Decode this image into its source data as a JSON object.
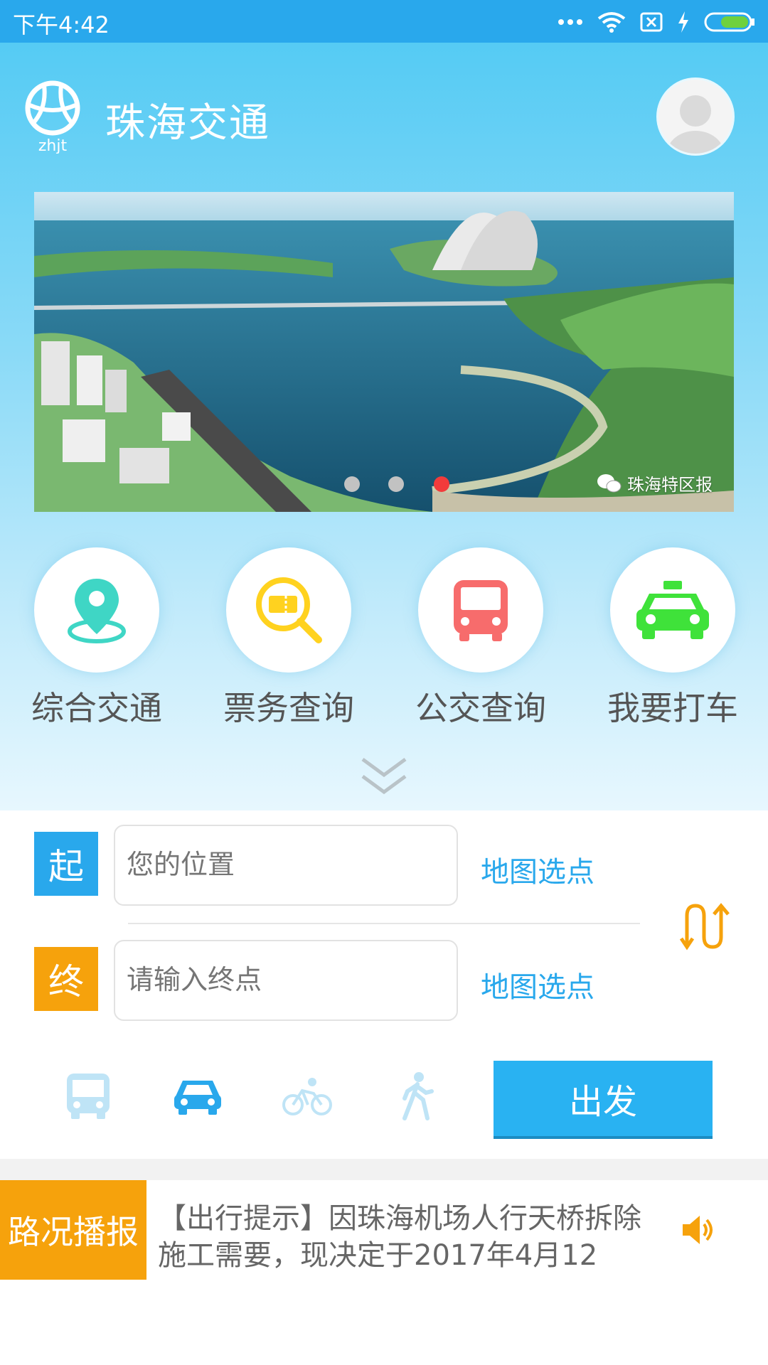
{
  "status_bar": {
    "time": "下午4:42",
    "battery_color": "#6fd13d"
  },
  "header": {
    "title": "珠海交通",
    "logo_text": "zhjt"
  },
  "banner": {
    "watermark": "珠海特区报",
    "dots": [
      {
        "active": false
      },
      {
        "active": false
      },
      {
        "active": true
      }
    ]
  },
  "features": [
    {
      "label": "综合交通",
      "icon": "location-pin-icon",
      "color": "#3fd6c5"
    },
    {
      "label": "票务查询",
      "icon": "ticket-search-icon",
      "color": "#ffd21f"
    },
    {
      "label": "公交查询",
      "icon": "bus-icon",
      "color": "#f76c6c"
    },
    {
      "label": "我要打车",
      "icon": "taxi-icon",
      "color": "#3fe23a"
    }
  ],
  "route": {
    "start_tag": "起",
    "end_tag": "终",
    "start_placeholder": "您的位置",
    "end_placeholder": "请输入终点",
    "map_pick_start": "地图选点",
    "map_pick_end": "地图选点",
    "go_label": "出发",
    "modes": [
      {
        "name": "bus",
        "icon": "bus-mode-icon",
        "selected": false
      },
      {
        "name": "car",
        "icon": "car-mode-icon",
        "selected": true
      },
      {
        "name": "bike",
        "icon": "bike-mode-icon",
        "selected": false
      },
      {
        "name": "walk",
        "icon": "walk-mode-icon",
        "selected": false
      }
    ],
    "accent": "#29a8ec",
    "orange": "#f6a20c"
  },
  "ticker": {
    "tag": "路况播报",
    "text": "【出行提示】因珠海机场人行天桥拆除施工需要，现决定于2017年4月12"
  }
}
